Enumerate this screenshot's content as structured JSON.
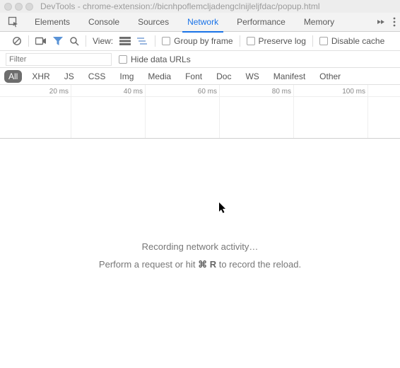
{
  "window": {
    "title": "DevTools - chrome-extension://bicnhpoflemcljadengclnijleljfdac/popup.html"
  },
  "tabs": {
    "items": [
      "Elements",
      "Console",
      "Sources",
      "Network",
      "Performance",
      "Memory"
    ],
    "active_index": 3
  },
  "toolbar": {
    "view_label": "View:",
    "group_label": "Group by frame",
    "preserve_label": "Preserve log",
    "disable_cache_label": "Disable cache"
  },
  "filter": {
    "placeholder": "Filter",
    "hide_data_urls_label": "Hide data URLs"
  },
  "types": {
    "items": [
      "All",
      "XHR",
      "JS",
      "CSS",
      "Img",
      "Media",
      "Font",
      "Doc",
      "WS",
      "Manifest",
      "Other"
    ],
    "active_index": 0
  },
  "timeline": {
    "ticks": [
      "20 ms",
      "40 ms",
      "60 ms",
      "80 ms",
      "100 ms"
    ]
  },
  "message": {
    "recording": "Recording network activity…",
    "hint_pre": "Perform a request or hit ",
    "hint_key": "⌘ R",
    "hint_post": " to record the reload."
  }
}
